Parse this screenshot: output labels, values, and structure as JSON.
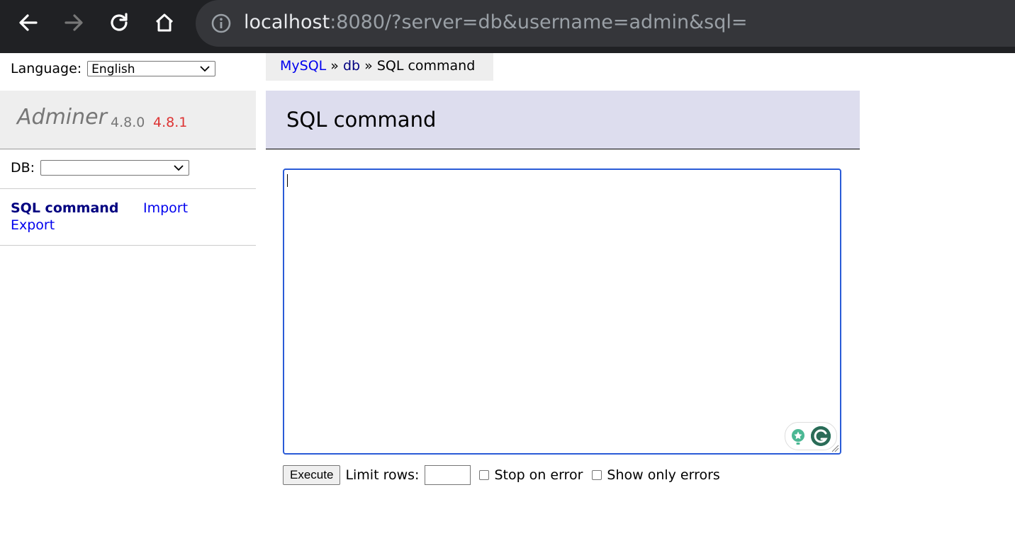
{
  "browser": {
    "url_host": "localhost",
    "url_rest": ":8080/?server=db&username=admin&sql=",
    "icons": [
      "back-icon",
      "forward-icon",
      "reload-icon",
      "home-icon",
      "info-icon"
    ]
  },
  "sidebar": {
    "language_label": "Language:",
    "language_value": "English",
    "app_name": "Adminer",
    "version": "4.8.0",
    "new_version": "4.8.1",
    "db_label": "DB:",
    "db_value": "",
    "links": {
      "sql_command": "SQL command",
      "import": "Import",
      "export": "Export"
    }
  },
  "breadcrumb": {
    "mysql": "MySQL",
    "sep1": " » ",
    "db": "db",
    "sep2": " » ",
    "current": "SQL command"
  },
  "main": {
    "title": "SQL command",
    "query_value": "",
    "execute_label": "Execute",
    "limit_label": "Limit rows:",
    "limit_value": "",
    "stop_on_error_label": "Stop on error",
    "stop_on_error_checked": false,
    "show_only_errors_label": "Show only errors",
    "show_only_errors_checked": false
  },
  "colors": {
    "link": "#0000ee",
    "current_link": "#000080",
    "header_bg": "#ddddee",
    "new_version": "#dd3333",
    "focus_border": "#2a5bd7"
  }
}
